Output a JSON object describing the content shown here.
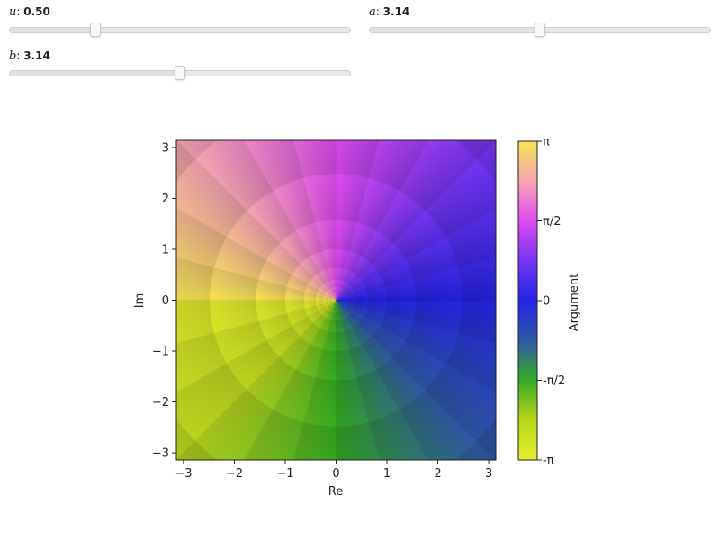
{
  "sliders": [
    {
      "symbol": "u",
      "value_text": "0.50",
      "fraction": 0.25
    },
    {
      "symbol": "a",
      "value_text": "3.14",
      "fraction": 0.5
    },
    {
      "symbol": "b",
      "value_text": "3.14",
      "fraction": 0.5
    }
  ],
  "chart_data": {
    "type": "heatmap",
    "description_kind": "domain-coloring",
    "xlabel": "Re",
    "ylabel": "Im",
    "xlim": [
      -3.14,
      3.14
    ],
    "ylim": [
      -3.14,
      3.14
    ],
    "x_ticks": [
      -3,
      -2,
      -1,
      0,
      1,
      2,
      3
    ],
    "x_tick_labels": [
      "−3",
      "−2",
      "−1",
      "0",
      "1",
      "2",
      "3"
    ],
    "y_ticks": [
      3,
      2,
      1,
      0,
      -1,
      -2,
      -3
    ],
    "y_tick_labels": [
      "3",
      "2",
      "1",
      "0",
      "−1",
      "−2",
      "−3"
    ],
    "colorbar": {
      "label": "Argument",
      "range": [
        -3.14159,
        3.14159
      ],
      "ticks": [
        3.14159,
        1.5708,
        0,
        -1.5708,
        -3.14159
      ],
      "tick_labels": [
        "π",
        "π/2",
        "0",
        "-π/2",
        "-π"
      ],
      "colors": [
        "#e6ef2c",
        "#b9d51e",
        "#34ac22",
        "#2f58a7",
        "#2424e5",
        "#7534f2",
        "#e04cf2",
        "#f7a6b2",
        "#f6e453"
      ]
    },
    "grid": false,
    "colors": {
      "text": "#222222",
      "axis": "#222222"
    }
  }
}
